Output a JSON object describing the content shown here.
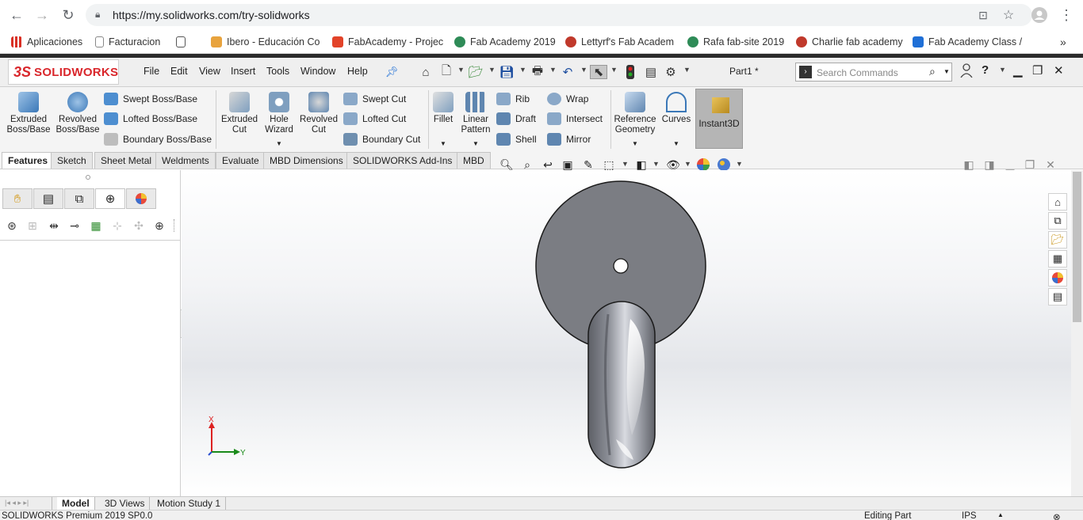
{
  "browser": {
    "url": "https://my.solidworks.com/try-solidworks",
    "bookmarks": [
      {
        "label": "Aplicaciones",
        "color": "#d93025"
      },
      {
        "label": "Facturacion",
        "color": "#888888"
      },
      {
        "label": "",
        "color": "#555555"
      },
      {
        "label": "Ibero - Educación Co",
        "color": "#e8a33d"
      },
      {
        "label": "FabAcademy - Projec",
        "color": "#e24329"
      },
      {
        "label": "Fab Academy 2019",
        "color": "#2e8b57"
      },
      {
        "label": "Lettyrf's Fab Academ",
        "color": "#c0392b"
      },
      {
        "label": "Rafa fab-site 2019",
        "color": "#2e8b57"
      },
      {
        "label": "Charlie fab academy",
        "color": "#c0392b"
      },
      {
        "label": "Fab Academy Class /",
        "color": "#1f6fd6"
      }
    ],
    "more": "»"
  },
  "sw": {
    "brand_ds": "3S",
    "brand": "SOLIDWORKS",
    "menu": [
      "File",
      "Edit",
      "View",
      "Insert",
      "Tools",
      "Window",
      "Help"
    ],
    "doc_title": "Part1 *",
    "search_placeholder": "Search Commands",
    "help_icon": "?"
  },
  "ribbon": {
    "extruded_boss": "Extruded Boss/Base",
    "revolved_boss": "Revolved Boss/Base",
    "swept_boss": "Swept Boss/Base",
    "lofted_boss": "Lofted Boss/Base",
    "boundary_boss": "Boundary Boss/Base",
    "extruded_cut": "Extruded Cut",
    "hole_wizard": "Hole Wizard",
    "revolved_cut": "Revolved Cut",
    "swept_cut": "Swept Cut",
    "lofted_cut": "Lofted Cut",
    "boundary_cut": "Boundary Cut",
    "fillet": "Fillet",
    "linear_pattern": "Linear Pattern",
    "rib": "Rib",
    "draft": "Draft",
    "shell": "Shell",
    "wrap": "Wrap",
    "intersect": "Intersect",
    "mirror": "Mirror",
    "reference_geometry": "Reference Geometry",
    "curves": "Curves",
    "instant3d": "Instant3D"
  },
  "tabs": [
    "Features",
    "Sketch",
    "Sheet Metal",
    "Weldments",
    "Evaluate",
    "MBD Dimensions",
    "SOLIDWORKS Add-Ins",
    "MBD"
  ],
  "triad": {
    "x_label": "X",
    "y_label": "Y"
  },
  "bottom_tabs": [
    "Model",
    "3D Views",
    "Motion Study 1"
  ],
  "status": {
    "product": "SOLIDWORKS Premium 2019 SP0.0",
    "mode": "Editing Part",
    "units": "IPS"
  },
  "colors": {
    "brand_red": "#d9262b",
    "part_gray": "#7b7d83",
    "handle_highlight": "#e8eaee"
  }
}
